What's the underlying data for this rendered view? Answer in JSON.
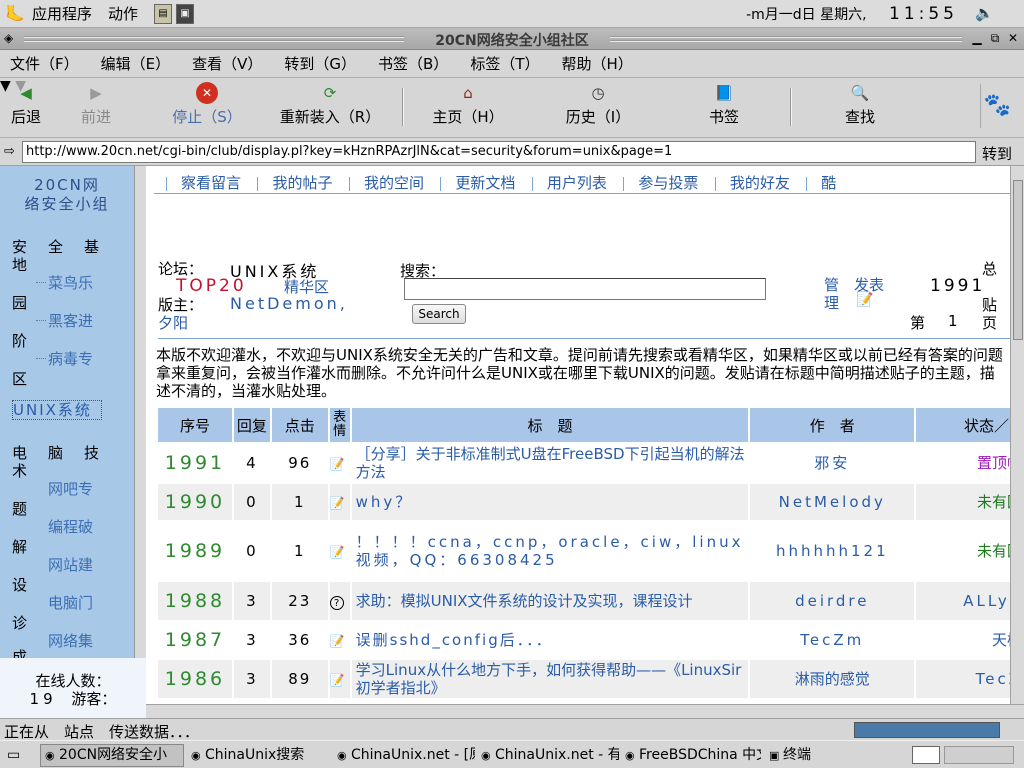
{
  "panel": {
    "apps": "应用程序",
    "actions": "动作",
    "date": "-m月一d日 星期六,",
    "time": "11:55"
  },
  "window": {
    "title": "20CN网络安全小组社区"
  },
  "menu": [
    "文件（F）",
    "编辑（E）",
    "查看（V）",
    "转到（G）",
    "书签（B）",
    "标签（T）",
    "帮助（H）"
  ],
  "toolbar": {
    "back": "后退",
    "forward": "前进",
    "stop": "停止（S）",
    "reload": "重新装入（R）",
    "home": "主页（H）",
    "history": "历史（I）",
    "bookmarks": "书签",
    "find": "查找"
  },
  "location": {
    "url": "http://www.20cn.net/cgi-bin/club/display.pl?key=kHznRPAzrJlN&cat=security&forum=unix&page=1",
    "go": "转到"
  },
  "left": {
    "brand": [
      "20CN网",
      "络安全小组"
    ],
    "group1_chars": [
      "安",
      "全",
      "基",
      "地"
    ],
    "items1": [
      "菜鸟乐",
      "黑客进",
      "病毒专"
    ],
    "vert1": [
      "园",
      "阶",
      "区"
    ],
    "current": "UNIX系统",
    "group2_chars": [
      "电",
      "脑",
      "技",
      "术"
    ],
    "items2": [
      "网吧专",
      "编程破",
      "网站建",
      "电脑门",
      "网络集"
    ],
    "vert2": [
      "题",
      "解",
      "设",
      "诊",
      "成"
    ],
    "online_label": "在线人数：",
    "online_count": "19",
    "guest_label": "游客："
  },
  "nav": [
    "察看留言",
    "我的帖子",
    "我的空间",
    "更新文档",
    "用户列表",
    "参与投票",
    "我的好友",
    "酷"
  ],
  "forum": {
    "label": "论坛：",
    "name": "UNIX系统",
    "top20": "TOP20",
    "elite": "精华区",
    "mod_label": "版主：",
    "mods": "NetDemon,",
    "mod2": "夕阳",
    "search_label": "搜索：",
    "search_btn": "Search",
    "manage": "管理",
    "post": "发表",
    "total_label": "总",
    "total": "1991",
    "posts_label": "贴",
    "page_label": "第",
    "page": "1",
    "page_unit": "页"
  },
  "rules": "本版不欢迎灌水，不欢迎与UNIX系统安全无关的广告和文章。提问前请先搜索或看精华区，如果精华区或以前已经有答案的问题拿来重复问，会被当作灌水而删除。不允许问什么是UNIX或在哪里下载UNIX的问题。发贴请在标题中简明描述贴子的主题，描述不清的，当灌水贴处理。",
  "table": {
    "headers": [
      "序号",
      "回复",
      "点击",
      "表情",
      "标　题",
      "作　者",
      "状态／回"
    ],
    "rows": [
      {
        "id": "1991",
        "replies": "4",
        "hits": "96",
        "icon": "doc",
        "title": "［分享］关于非标准制式U盘在FreeBSD下引起当机的解法方法",
        "author": "邪安",
        "status": "置顶帖"
      },
      {
        "id": "1990",
        "replies": "0",
        "hits": "1",
        "icon": "doc",
        "title": "why？",
        "author": "NetMelody",
        "status": "未有回"
      },
      {
        "id": "1989",
        "replies": "0",
        "hits": "1",
        "icon": "doc",
        "title": "！！！！ccna，ccnp，oracle，ciw，linux视频，QQ：66308425",
        "author": "hhhhhh121",
        "status": "未有回"
      },
      {
        "id": "1988",
        "replies": "3",
        "hits": "23",
        "icon": "question",
        "title": "求助：模拟UNIX文件系统的设计及实现，课程设计",
        "author": "deirdre",
        "status": "ALLye"
      },
      {
        "id": "1987",
        "replies": "3",
        "hits": "36",
        "icon": "doc",
        "title": "误删sshd_config后．．．",
        "author": "TecZm",
        "status": "天枫"
      },
      {
        "id": "1986",
        "replies": "3",
        "hits": "89",
        "icon": "doc",
        "title": "学习Linux从什么地方下手，如何获得帮助——《LinuxSir初学者指北》",
        "author": "淋雨的感觉",
        "status": "TecZ"
      }
    ]
  },
  "status": "正在从　站点　传送数据．．．",
  "tasks": [
    "20CN网络安全小",
    "ChinaUnix搜索",
    "ChinaUnix.net - [原",
    "ChinaUnix.net - 有",
    "FreeBSDChina 中文",
    "终端"
  ],
  "colors": {
    "nav_blue": "#2a5ca8",
    "header_bg": "#a9c6e8",
    "id_green": "#2f8a2f",
    "left_bg": "#a8c8e8",
    "pin_purple": "#9b1fb5",
    "no_reply_green": "#1f7a1f"
  }
}
